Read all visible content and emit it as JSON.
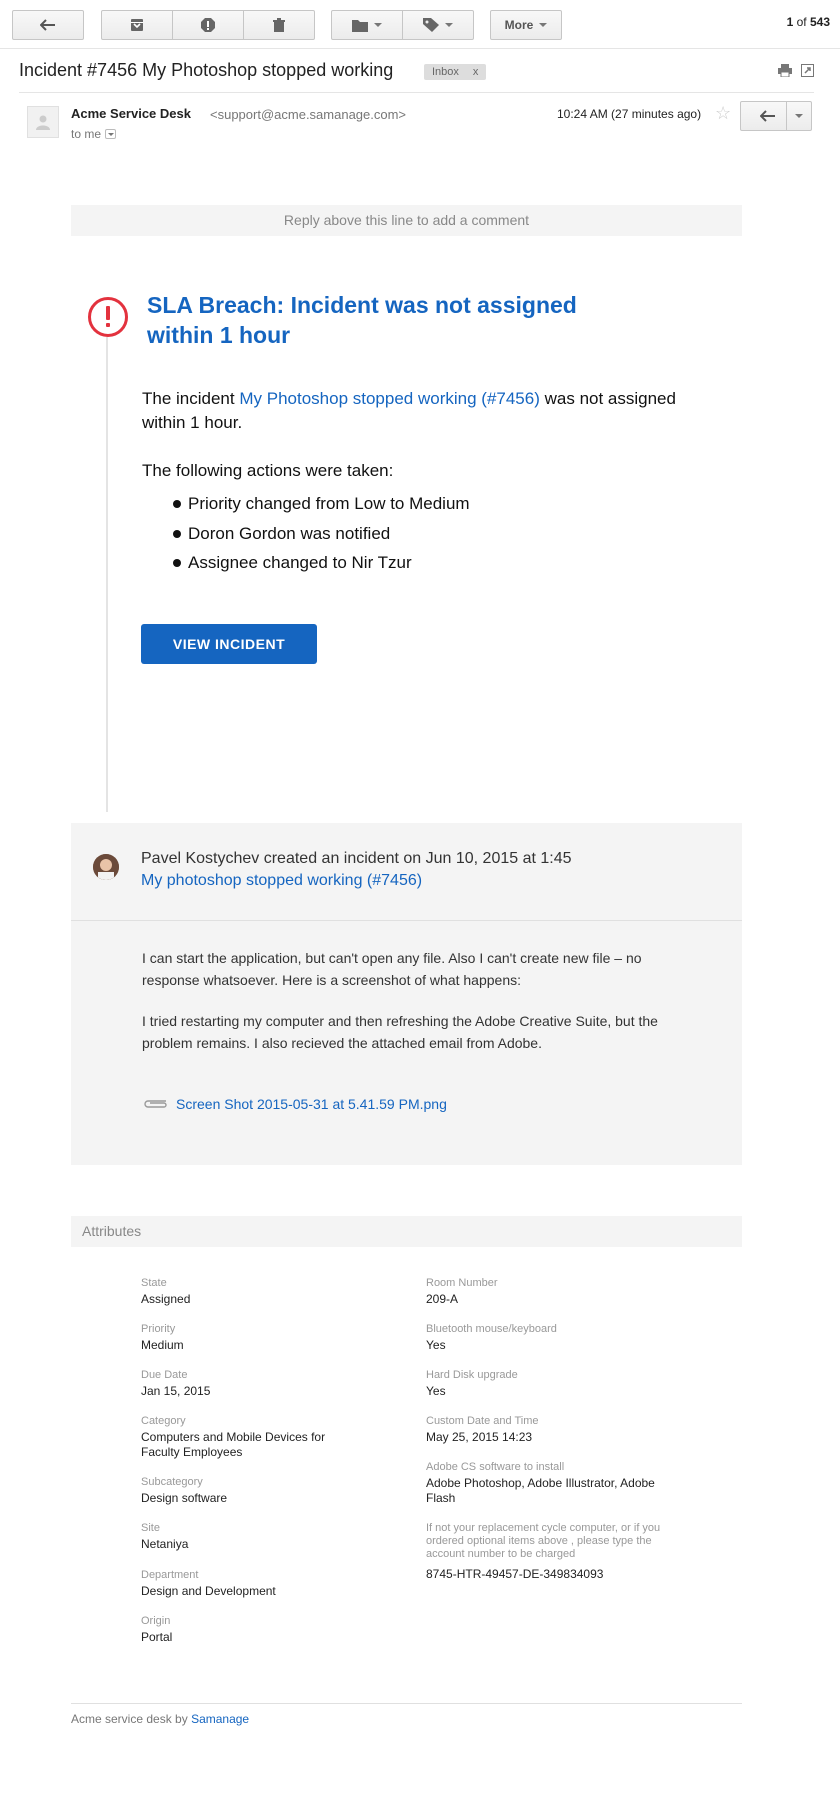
{
  "toolbar": {
    "more_label": "More",
    "pager_current": "1",
    "pager_of": "of",
    "pager_total": "543"
  },
  "email": {
    "subject": "Incident #7456 My Photoshop stopped working",
    "label": "Inbox",
    "label_remove": "x",
    "sender_name": "Acme Service Desk",
    "sender_email": "<support@acme.samanage.com>",
    "to": "to me",
    "time": "10:24 AM (27 minutes ago)"
  },
  "body": {
    "reply_line": "Reply above this line to add a comment",
    "sla_title": "SLA Breach: Incident was not assigned within 1 hour",
    "incident_prefix": "The incident",
    "incident_link": "My Photoshop stopped working (#7456)",
    "incident_suffix": "was not assigned within 1 hour.",
    "actions_head": "The following actions were taken:",
    "actions": [
      "Priority changed from Low to Medium",
      "Doron Gordon was notified",
      "Assignee changed to Nir Tzur"
    ],
    "view_button": "VIEW INCIDENT"
  },
  "activity": {
    "line": "Pavel Kostychev created an incident on Jun 10, 2015 at 1:45",
    "link": "My photoshop stopped working (#7456)",
    "desc1": "I can start the application, but can't open any file. Also I can't create new file – no response whatsoever. Here is a screenshot of what happens:",
    "desc2": "I tried restarting my computer and then refreshing the Adobe Creative Suite, but the problem remains. I also recieved the attached email from Adobe.",
    "attachment": "Screen Shot 2015-05-31 at 5.41.59 PM.png"
  },
  "attributes": {
    "title": "Attributes",
    "left": [
      {
        "label": "State",
        "value": "Assigned"
      },
      {
        "label": "Priority",
        "value": "Medium"
      },
      {
        "label": "Due Date",
        "value": "Jan 15, 2015"
      },
      {
        "label": "Category",
        "value": "Computers and Mobile Devices for Faculty Employees"
      },
      {
        "label": "Subcategory",
        "value": "Design software"
      },
      {
        "label": "Site",
        "value": "Netaniya"
      },
      {
        "label": "Department",
        "value": "Design and Development"
      },
      {
        "label": "Origin",
        "value": "Portal"
      }
    ],
    "right": [
      {
        "label": "Room Number",
        "value": "209-A"
      },
      {
        "label": "Bluetooth mouse/keyboard",
        "value": "Yes"
      },
      {
        "label": "Hard Disk upgrade",
        "value": "Yes"
      },
      {
        "label": "Custom Date and Time",
        "value": "May 25, 2015 14:23"
      },
      {
        "label": "Adobe CS software to install",
        "value": "Adobe Photoshop, Adobe Illustrator, Adobe Flash"
      },
      {
        "label": "If not your replacement cycle computer, or if you ordered optional items above , please type the account number to be charged",
        "value": "8745-HTR-49457-DE-349834093"
      }
    ]
  },
  "footer": {
    "prefix": "Acme service desk by",
    "link": "Samanage"
  },
  "colors": {
    "link_blue": "#1565c0",
    "alert_red": "#e3323e"
  }
}
